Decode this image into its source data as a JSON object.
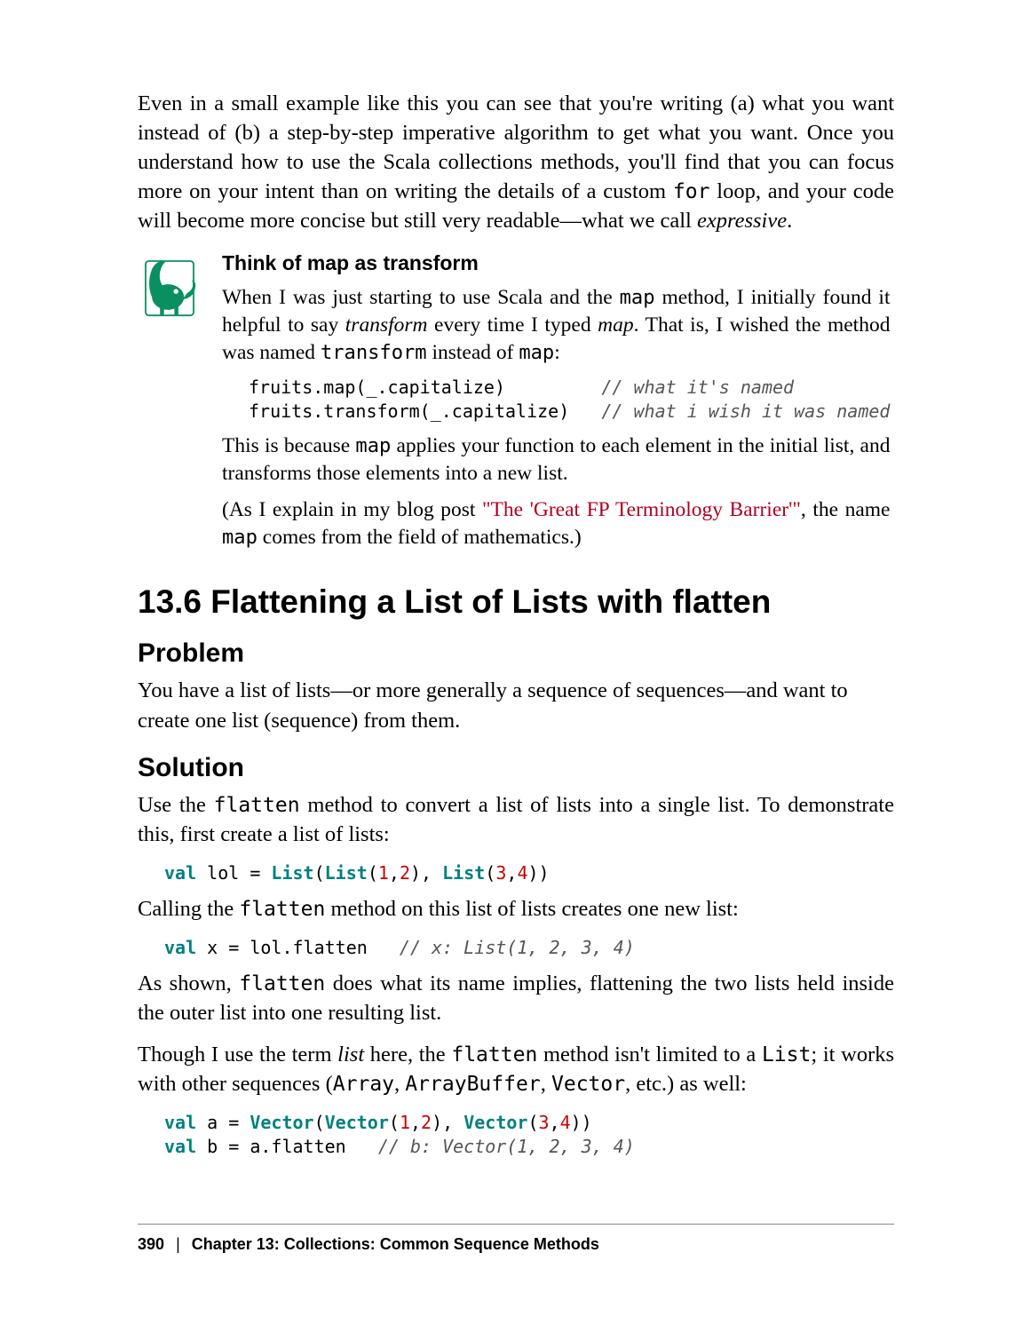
{
  "intro_para": {
    "pre": "Even in a small example like this you can see that you're writing (a) what you want instead of (b) a step-by-step imperative algorithm to get what you want. Once you understand how to use the Scala collections methods, you'll find that you can focus more on your intent than on writing the details of a custom ",
    "code": "for",
    "mid": " loop, and your code will become more concise but still very readable—what we call ",
    "em": "expressive",
    "post": "."
  },
  "tip": {
    "title": "Think of map as transform",
    "p1": {
      "a": "When I was just starting to use Scala and the ",
      "code1": "map",
      "b": " method, I initially found it helpful to say ",
      "em1": "transform",
      "c": " every time I typed ",
      "em2": "map",
      "d": ". That is, I wished the method was named ",
      "code2": "transform",
      "e": " instead of ",
      "code3": "map",
      "f": ":"
    },
    "code": {
      "l1a": "fruits.map(_.capitalize)         ",
      "l1b": "// what it's named",
      "l2a": "fruits.transform(_.capitalize)   ",
      "l2b": "// what i wish it was named"
    },
    "p2": {
      "a": "This is because ",
      "code": "map",
      "b": " applies your function to each element in the initial list, and transforms those elements into a new list."
    },
    "p3": {
      "a": "(As I explain in my blog post ",
      "link": "\"The 'Great FP Terminology Barrier'\"",
      "b": ", the name ",
      "code": "map",
      "c": " comes from the field of mathematics.)"
    }
  },
  "section": {
    "title": "13.6 Flattening a List of Lists with flatten",
    "problem_h": "Problem",
    "problem_p": "You have a list of lists—or more generally a sequence of sequences—and want to create one list (sequence) from them.",
    "solution_h": "Solution",
    "sol_p1": {
      "a": "Use the ",
      "code": "flatten",
      "b": " method to convert a list of lists into a single list. To demonstrate this, first create a list of lists:"
    },
    "code1": {
      "kw": "val",
      "a": " lol = ",
      "fn1": "List",
      "b": "(",
      "fn2": "List",
      "c": "(",
      "n1": "1",
      "d": ",",
      "n2": "2",
      "e": "), ",
      "fn3": "List",
      "f": "(",
      "n3": "3",
      "g": ",",
      "n4": "4",
      "h": "))"
    },
    "sol_p2": {
      "a": "Calling the ",
      "code": "flatten",
      "b": " method on this list of lists creates one new list:"
    },
    "code2": {
      "kw": "val",
      "a": " x = lol.flatten   ",
      "cm": "// x: List(1, 2, 3, 4)"
    },
    "sol_p3": {
      "a": "As shown, ",
      "code": "flatten",
      "b": " does what its name implies, flattening the two lists held inside the outer list into one resulting list."
    },
    "sol_p4": {
      "a": "Though I use the term ",
      "em": "list",
      "b": " here, the ",
      "code1": "flatten",
      "c": " method isn't limited to a ",
      "code2": "List",
      "d": "; it works with other sequences (",
      "code3": "Array",
      "e": ", ",
      "code4": "ArrayBuffer",
      "f": ", ",
      "code5": "Vector",
      "g": ", etc.) as well:"
    },
    "code3": {
      "l1": {
        "kw": "val",
        "a": " a = ",
        "fn1": "Vector",
        "b": "(",
        "fn2": "Vector",
        "c": "(",
        "n1": "1",
        "d": ",",
        "n2": "2",
        "e": "), ",
        "fn3": "Vector",
        "f": "(",
        "n3": "3",
        "g": ",",
        "n4": "4",
        "h": "))"
      },
      "l2": {
        "kw": "val",
        "a": " b = a.flatten   ",
        "cm": "// b: Vector(1, 2, 3, 4)"
      }
    }
  },
  "footer": {
    "page": "390",
    "sep": "|",
    "chapter": "Chapter 13: Collections: Common Sequence Methods"
  }
}
